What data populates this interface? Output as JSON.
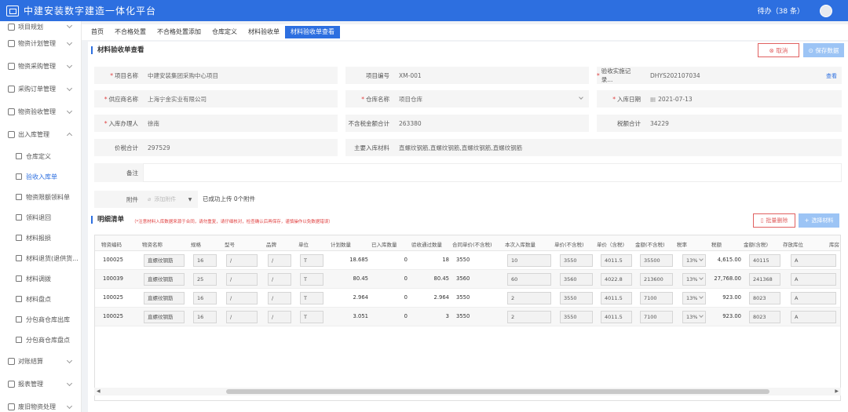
{
  "app": {
    "title": "中建安装数字建造一体化平台",
    "todo": "待办（38 条）"
  },
  "sidebar": {
    "items": [
      {
        "label": "项目规划"
      },
      {
        "label": "物资计划管理"
      },
      {
        "label": "物资采购管理"
      },
      {
        "label": "采购订单管理"
      },
      {
        "label": "物资验收管理"
      },
      {
        "label": "出入库管理"
      }
    ],
    "subitems": [
      {
        "label": "仓库定义"
      },
      {
        "label": "验收入库单"
      },
      {
        "label": "物资限额领料单"
      },
      {
        "label": "领料退回"
      },
      {
        "label": "材料报损"
      },
      {
        "label": "材料退货(退供货..."
      },
      {
        "label": "材料调拨"
      },
      {
        "label": "材料盘点"
      },
      {
        "label": "分包商仓库出库"
      },
      {
        "label": "分包商仓库盘点"
      }
    ],
    "bottom": [
      {
        "label": "对账结算"
      },
      {
        "label": "报表管理"
      },
      {
        "label": "废旧物资处理"
      }
    ]
  },
  "tabs": [
    "首页",
    "不合格处置",
    "不合格处置添加",
    "仓库定义",
    "材料验收单",
    "材料验收单查看"
  ],
  "page": {
    "title": "材料验收单查看",
    "cancel": "取消",
    "save": "保存数据"
  },
  "form": {
    "project_name_label": "项目名称",
    "project_name": "中建安装集团采购中心项目",
    "project_code_label": "项目编号",
    "project_code": "XM-001",
    "contract_label": "验收实施记录...",
    "contract": "DHYS202107034",
    "contract_view": "查看",
    "supplier_label": "供应商名称",
    "supplier": "上海宁金实业有限公司",
    "warehouse_label": "仓库名称",
    "warehouse": "项目仓库",
    "date_label": "入库日期",
    "date": "2021-07-13",
    "handler_label": "入库办理人",
    "handler": "徐南",
    "amount_notax_label": "不含税金额合计",
    "amount_notax": "263380",
    "tax_label": "税额合计",
    "tax": "34229",
    "total_label": "价税合计",
    "total": "297529",
    "materials_label": "主要入库材料",
    "materials": "直螺纹钢筋,直螺纹钢筋,直螺纹钢筋,直螺纹钢筋",
    "remark_label": "备注",
    "remark": "",
    "attach_label": "附件",
    "attach_upload": "添加附件",
    "attach_status": "已成功上传 0个附件"
  },
  "detail": {
    "title": "明细清单",
    "note": "（*注意材料入库数据来源于合同，请勿重复，请仔细核对，检查确认后再保存，谨慎操作以免数据错误）",
    "batch_delete": "批量删除",
    "select_material": "选择材料",
    "columns": [
      "物资编码",
      "物资名称",
      "规格",
      "型号",
      "品牌",
      "单位",
      "计划数量",
      "已入库数量",
      "验收通过数量",
      "合同单价(不含税)",
      "本次入库数量",
      "单价(不含税)",
      "单价（含税)",
      "金额(不含税)",
      "税率",
      "税额",
      "金额(含税)",
      "存放库位",
      "库房"
    ],
    "rows": [
      {
        "code": "100025",
        "name": "直螺纹钢筋",
        "spec": "16",
        "model": "/",
        "brand": "/",
        "unit": "T",
        "plan": "18.685",
        "stocked": "0",
        "passed": "18",
        "contract_price": "3550",
        "qty": "10",
        "price": "3550",
        "price_tax": "4011.5",
        "amount": "35500",
        "rate": "13%",
        "tax": "4,615.00",
        "amount_tax": "40115",
        "loc": "A"
      },
      {
        "code": "100039",
        "name": "直螺纹钢筋",
        "spec": "25",
        "model": "/",
        "brand": "/",
        "unit": "T",
        "plan": "80.45",
        "stocked": "0",
        "passed": "80.45",
        "contract_price": "3560",
        "qty": "60",
        "price": "3560",
        "price_tax": "4022.8",
        "amount": "213600",
        "rate": "13%",
        "tax": "27,768.00",
        "amount_tax": "241368",
        "loc": "A"
      },
      {
        "code": "100025",
        "name": "直螺纹钢筋",
        "spec": "16",
        "model": "/",
        "brand": "/",
        "unit": "T",
        "plan": "2.964",
        "stocked": "0",
        "passed": "2.964",
        "contract_price": "3550",
        "qty": "2",
        "price": "3550",
        "price_tax": "4011.5",
        "amount": "7100",
        "rate": "13%",
        "tax": "923.00",
        "amount_tax": "8023",
        "loc": "A"
      },
      {
        "code": "100025",
        "name": "直螺纹钢筋",
        "spec": "16",
        "model": "/",
        "brand": "/",
        "unit": "T",
        "plan": "3.051",
        "stocked": "0",
        "passed": "3",
        "contract_price": "3550",
        "qty": "2",
        "price": "3550",
        "price_tax": "4011.5",
        "amount": "7100",
        "rate": "13%",
        "tax": "923.00",
        "amount_tax": "8023",
        "loc": "A"
      }
    ]
  }
}
